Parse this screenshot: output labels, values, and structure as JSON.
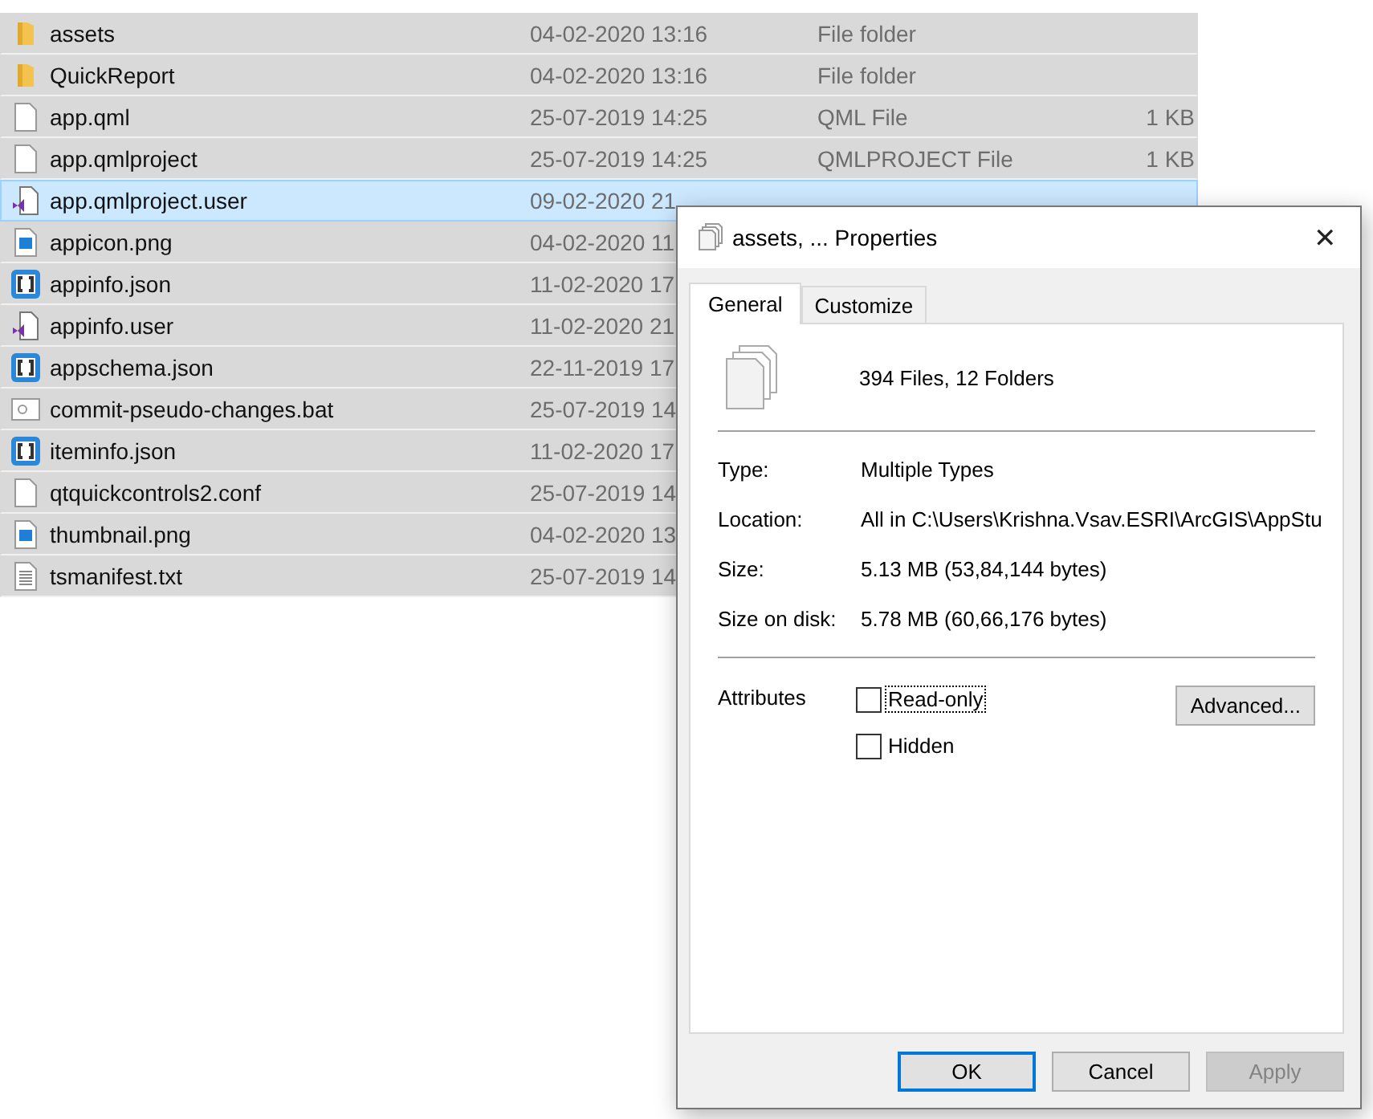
{
  "files": [
    {
      "kind": "folder",
      "name": "assets",
      "date": "04-02-2020 13:16",
      "type": "File folder",
      "selected": false
    },
    {
      "kind": "folder",
      "name": "QuickReport",
      "date": "04-02-2020 13:16",
      "type": "File folder",
      "selected": false
    },
    {
      "kind": "file",
      "name": "app.qml",
      "date": "25-07-2019 14:25",
      "type": "QML File",
      "size": "1 KB",
      "selected": false
    },
    {
      "kind": "file",
      "name": "app.qmlproject",
      "date": "25-07-2019 14:25",
      "type": "QMLPROJECT File",
      "size": "1 KB",
      "selected": false
    },
    {
      "kind": "vs",
      "name": "app.qmlproject.user",
      "date": "09-02-2020 21",
      "selected": true
    },
    {
      "kind": "image",
      "name": "appicon.png",
      "date": "04-02-2020 11",
      "selected": false
    },
    {
      "kind": "json",
      "name": "appinfo.json",
      "date": "11-02-2020 17",
      "selected": false
    },
    {
      "kind": "vs",
      "name": "appinfo.user",
      "date": "11-02-2020 21",
      "selected": false
    },
    {
      "kind": "json",
      "name": "appschema.json",
      "date": "22-11-2019 17",
      "selected": false
    },
    {
      "kind": "bat",
      "name": "commit-pseudo-changes.bat",
      "date": "25-07-2019 14",
      "selected": false
    },
    {
      "kind": "json",
      "name": "iteminfo.json",
      "date": "11-02-2020 17",
      "selected": false
    },
    {
      "kind": "file",
      "name": "qtquickcontrols2.conf",
      "date": "25-07-2019 14",
      "selected": false
    },
    {
      "kind": "image",
      "name": "thumbnail.png",
      "date": "04-02-2020 13",
      "selected": false
    },
    {
      "kind": "text",
      "name": "tsmanifest.txt",
      "date": "25-07-2019 14",
      "selected": false
    }
  ],
  "dialog": {
    "title": "assets, ... Properties",
    "close": "✕",
    "tabs": [
      {
        "label": "General",
        "selected": true
      },
      {
        "label": "Customize",
        "selected": false
      }
    ],
    "summary": "394 Files, 12 Folders",
    "properties": [
      {
        "label": "Type:",
        "value": "Multiple Types"
      },
      {
        "label": "Location:",
        "value": "All in C:\\Users\\Krishna.Vsav.ESRI\\ArcGIS\\AppStu"
      },
      {
        "label": "Size:",
        "value": "5.13 MB (53,84,144 bytes)"
      },
      {
        "label": "Size on disk:",
        "value": "5.78 MB (60,66,176 bytes)"
      }
    ],
    "attributes_label": "Attributes",
    "attributes": [
      {
        "label": "Read-only",
        "checked": false,
        "focused": true
      },
      {
        "label": "Hidden",
        "checked": false,
        "focused": false
      }
    ],
    "advanced": "Advanced...",
    "buttons": [
      {
        "label": "OK",
        "default": true,
        "disabled": false
      },
      {
        "label": "Cancel",
        "default": false,
        "disabled": false
      },
      {
        "label": "Apply",
        "default": false,
        "disabled": true
      }
    ]
  }
}
